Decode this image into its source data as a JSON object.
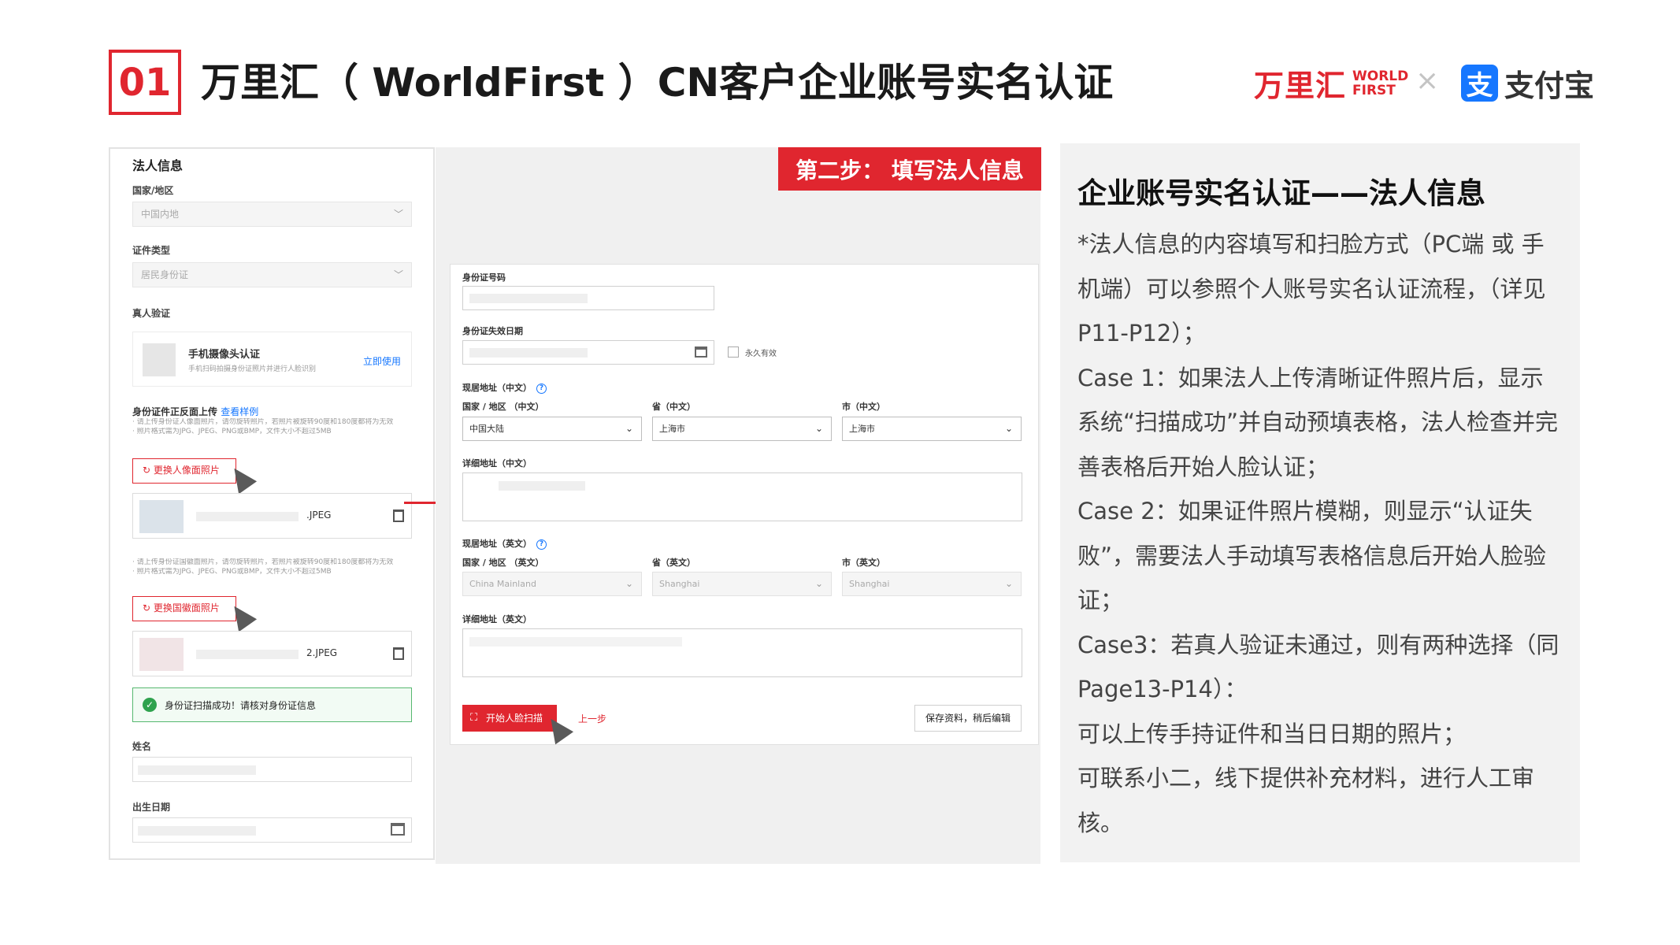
{
  "header": {
    "number": "01",
    "title": "万里汇（ WorldFirst ）CN客户企业账号实名认证",
    "logo_worldfirst_cn": "万里汇",
    "logo_worldfirst_en_1": "WORLD",
    "logo_worldfirst_en_2": "FIRST",
    "logo_separator": "×",
    "logo_alipay_icon": "支",
    "logo_alipay": "支付宝"
  },
  "step_banner": "第二步： 填写法人信息",
  "left_form": {
    "section_title": "法人信息",
    "country_label": "国家/地区",
    "country_value": "中国内地",
    "id_type_label": "证件类型",
    "id_type_value": "居民身份证",
    "verify_label": "真人验证",
    "camera_title": "手机摄像头认证",
    "camera_desc": "手机扫码拍摄身份证照片并进行人脸识别",
    "camera_action": "立即使用",
    "upload_label": "身份证件正反面上传",
    "upload_example": "查看样例",
    "upload_note_1": "· 请上传身份证人像面照片，请勿旋转照片，若照片被旋转90度和180度都将为无效",
    "upload_note_2": "· 照片格式需为JPG、JPEG、PNG或BMP，文件大小不超过5MB",
    "replace_portrait": "更换人像面照片",
    "file_1_name": ".JPEG",
    "upload_note_3": "· 请上传身份证国徽面照片，请勿旋转照片，若照片被旋转90度和180度都将为无效",
    "upload_note_4": "· 照片格式需为JPG、JPEG、PNG或BMP，文件大小不超过5MB",
    "replace_emblem": "更换国徽面照片",
    "file_2_name": "2.JPEG",
    "success_msg": "身份证扫描成功！请核对身份证信息",
    "name_label": "姓名",
    "dob_label": "出生日期"
  },
  "mid_form": {
    "id_number_label": "身份证号码",
    "id_expiry_label": "身份证失效日期",
    "permanent_label": "永久有效",
    "address_cn_label": "现居地址（中文）",
    "country_cn_label": "国家 / 地区 （中文）",
    "country_cn_value": "中国大陆",
    "province_cn_label": "省（中文）",
    "province_cn_value": "上海市",
    "city_cn_label": "市（中文）",
    "city_cn_value": "上海市",
    "detail_cn_label": "详细地址（中文）",
    "address_en_label": "现居地址（英文）",
    "country_en_label": "国家 / 地区 （英文）",
    "country_en_value": "China Mainland",
    "province_en_label": "省（英文）",
    "province_en_value": "Shanghai",
    "city_en_label": "市（英文）",
    "city_en_value": "Shanghai",
    "detail_en_label": "详细地址（英文）",
    "start_scan": "开始人脸扫描",
    "prev_step": "上一步",
    "save_later": "保存资料，稍后编辑"
  },
  "right_panel": {
    "title": "企业账号实名认证——法人信息",
    "paragraphs": [
      "*法人信息的内容填写和扫脸方式（PC端 或 手机端）可以参照个人账号实名认证流程，（详见P11-P12）；",
      "Case 1：如果法人上传清晰证件照片后，显示系统“扫描成功”并自动预填表格，法人检查并完善表格后开始人脸认证；",
      "Case 2：如果证件照片模糊，则显示“认证失败”，需要法人手动填写表格信息后开始人脸验证；",
      "Case3：若真人验证未通过，则有两种选择（同Page13-P14）：",
      "可以上传手持证件和当日日期的照片；",
      "可联系小二，线下提供补充材料，进行人工审核。"
    ]
  },
  "colors": {
    "accent": "#e0262f",
    "alipay_blue": "#1677ff",
    "success_green": "#2fa24e"
  }
}
